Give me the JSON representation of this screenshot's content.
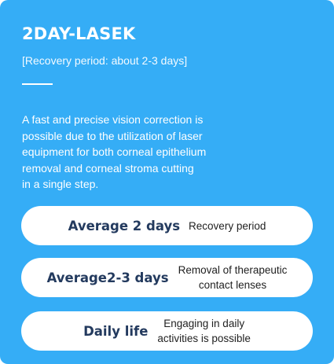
{
  "header": {
    "title": "2DAY-LASEK",
    "subtitle": "[Recovery period: about 2-3 days]"
  },
  "description": {
    "lines": [
      "A fast and precise vision correction is",
      "possible due to the utilization of laser",
      "equipment for both corneal epithelium",
      "removal and corneal stroma cutting",
      "in a single step."
    ]
  },
  "stats": [
    {
      "value": "Average 2 days",
      "label_lines": [
        "Recovery period"
      ]
    },
    {
      "value": "Average2-3 days",
      "label_lines": [
        "Removal of therapeutic",
        "contact lenses"
      ]
    },
    {
      "value": "Daily life",
      "label_lines": [
        "Engaging in daily",
        "activities is possible"
      ]
    }
  ],
  "colors": {
    "background": "#35adf6",
    "pill": "#ffffff",
    "value_text": "#233a5e"
  }
}
